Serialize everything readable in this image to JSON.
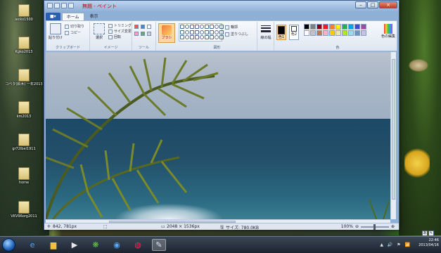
{
  "window": {
    "title": "無題 - ペイント",
    "title_color": "#cc0000",
    "buttons": [
      "–",
      "□",
      "×"
    ]
  },
  "tabs": [
    {
      "label": "■▾"
    },
    {
      "label": "ホーム"
    },
    {
      "label": "表示"
    }
  ],
  "ribbon": {
    "clipboard": {
      "paste": "貼り付け",
      "cut": "切り取り",
      "copy": "コピー",
      "group": "クリップボード"
    },
    "image": {
      "select": "選択",
      "crop": "トリミング",
      "resize": "サイズ変更",
      "rotate": "回転",
      "group": "イメージ"
    },
    "tools": {
      "group": "ツール"
    },
    "brush": {
      "label": "ブラシ"
    },
    "shapes": {
      "outline": "輪郭",
      "fill": "塗りつぶし",
      "group": "図形"
    },
    "size": {
      "label": "線の幅"
    },
    "color1": {
      "label": "色1",
      "value": "#000000"
    },
    "color2": {
      "label": "色2",
      "value": "#ffffff"
    },
    "colors": {
      "group": "色",
      "edit": "色の編集",
      "palette": [
        "#000000",
        "#7f7f7f",
        "#880015",
        "#ed1c24",
        "#ff7f27",
        "#fff200",
        "#22b14c",
        "#00a2e8",
        "#3f48cc",
        "#a349a4",
        "#ffffff",
        "#c3c3c3",
        "#b97a57",
        "#ffaec9",
        "#ffc90e",
        "#efe4b0",
        "#b5e61d",
        "#99d9ea",
        "#7092be",
        "#c8bfe7"
      ]
    }
  },
  "status": {
    "cursor": "842, 781px",
    "image_size": "2048 × 1536px",
    "file_size": "サイズ: 780.0KB",
    "zoom": "100%",
    "zoom_level": 0.5
  },
  "desktop": {
    "icons": [
      {
        "label": "lecko1500"
      },
      {
        "label": "Kgko2013"
      },
      {
        "label": "コベタ(鈴木)\n一年2013"
      },
      {
        "label": "km2013"
      },
      {
        "label": "gr72ibel1911"
      },
      {
        "label": "home"
      },
      {
        "label": "VKV96org2011"
      }
    ]
  },
  "taskbar": {
    "apps": [
      {
        "icon": "internet-explorer-icon",
        "glyph": "e"
      },
      {
        "icon": "file-explorer-icon",
        "glyph": "▆"
      },
      {
        "icon": "media-player-icon",
        "glyph": "▶"
      },
      {
        "icon": "app-green-icon",
        "glyph": "❋"
      },
      {
        "icon": "app-blue-icon",
        "glyph": "◉"
      },
      {
        "icon": "chrome-icon",
        "glyph": "◍"
      },
      {
        "icon": "paint-icon",
        "glyph": "✎"
      }
    ],
    "time": "22:46",
    "date": "2013/04/16",
    "tray": "▲ 🔊 ⚑ 📶"
  }
}
